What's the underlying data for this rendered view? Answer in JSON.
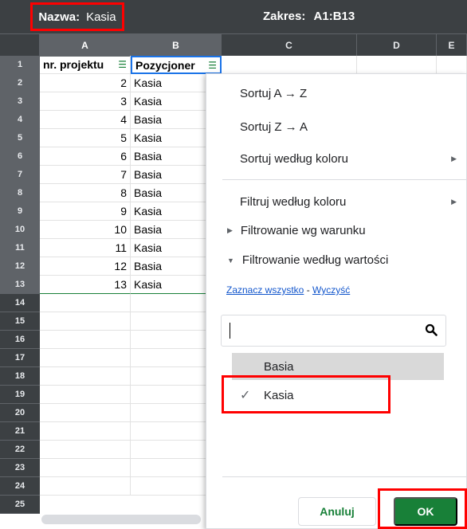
{
  "filter_bar": {
    "name_label": "Nazwa:",
    "name_value": "Kasia",
    "range_label": "Zakres:",
    "range_value": "A1:B13"
  },
  "columns": [
    "A",
    "B",
    "C",
    "D",
    "E"
  ],
  "row_numbers": [
    "1",
    "2",
    "3",
    "4",
    "5",
    "6",
    "7",
    "8",
    "9",
    "10",
    "11",
    "12",
    "13",
    "14",
    "15",
    "16",
    "17",
    "18",
    "19",
    "20",
    "21",
    "22",
    "23",
    "24",
    "25"
  ],
  "header_row": {
    "col_a": "nr. projektu",
    "col_b": "Pozycjoner"
  },
  "data_rows": [
    {
      "a": "2",
      "b": "Kasia"
    },
    {
      "a": "3",
      "b": "Kasia"
    },
    {
      "a": "4",
      "b": "Basia"
    },
    {
      "a": "5",
      "b": "Kasia"
    },
    {
      "a": "6",
      "b": "Basia"
    },
    {
      "a": "7",
      "b": "Basia"
    },
    {
      "a": "8",
      "b": "Basia"
    },
    {
      "a": "9",
      "b": "Kasia"
    },
    {
      "a": "10",
      "b": "Basia"
    },
    {
      "a": "11",
      "b": "Kasia"
    },
    {
      "a": "12",
      "b": "Basia"
    },
    {
      "a": "13",
      "b": "Kasia"
    }
  ],
  "filter_menu": {
    "sort_az": "Sortuj A → Z",
    "sort_za": "Sortuj Z → A",
    "sort_by_color": "Sortuj według koloru",
    "filter_by_color": "Filtruj według koloru",
    "filter_by_condition": "Filtrowanie wg warunku",
    "filter_by_values": "Filtrowanie według wartości",
    "select_all": "Zaznacz wszystko",
    "separator": " - ",
    "clear": "Wyczyść",
    "search_placeholder": "",
    "values": [
      {
        "label": "Basia",
        "checked": false
      },
      {
        "label": "Kasia",
        "checked": true
      }
    ],
    "cancel_label": "Anuluj",
    "ok_label": "OK"
  },
  "colors": {
    "accent_green": "#188038",
    "highlight_red": "#ff0000",
    "header_dark": "#3c4043"
  }
}
